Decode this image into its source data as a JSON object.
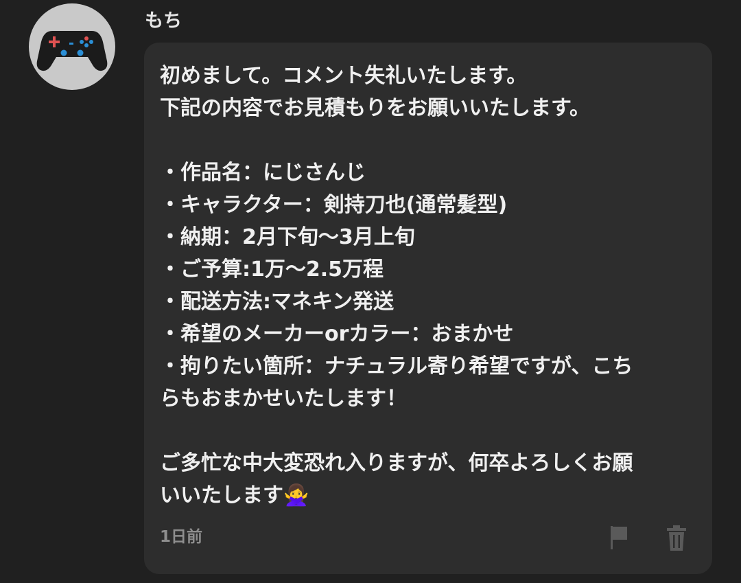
{
  "comment": {
    "author": "もち",
    "avatar_icon": "gamepad-icon",
    "body_lines": [
      "初めまして。コメント失礼いたします。",
      "下記の内容でお見積もりをお願いいたします。",
      "",
      "・作品名：にじさんじ",
      "・キャラクター：剣持刀也(通常髪型)",
      "・納期：2月下旬〜3月上旬",
      "・ご予算:1万〜2.5万程",
      "・配送方法:マネキン発送",
      "・希望のメーカーorカラー：おまかせ",
      "・拘りたい箇所：ナチュラル寄り希望ですが、こち",
      "らもおまかせいたします！",
      "",
      "ご多忙な中大変恐れ入りますが、何卒よろしくお願",
      "いいたします🙅‍♀️"
    ],
    "timestamp": "1日前",
    "actions": {
      "flag_icon": "flag-icon",
      "delete_icon": "trash-icon"
    }
  },
  "colors": {
    "background": "#202020",
    "bubble": "#2d2d2d",
    "text": "#f0f0f0",
    "muted": "#8e8e8e",
    "avatar_bg": "#c9c9c9",
    "gamepad_plus": "#e05252",
    "gamepad_buttons": "#2b8fd6"
  }
}
